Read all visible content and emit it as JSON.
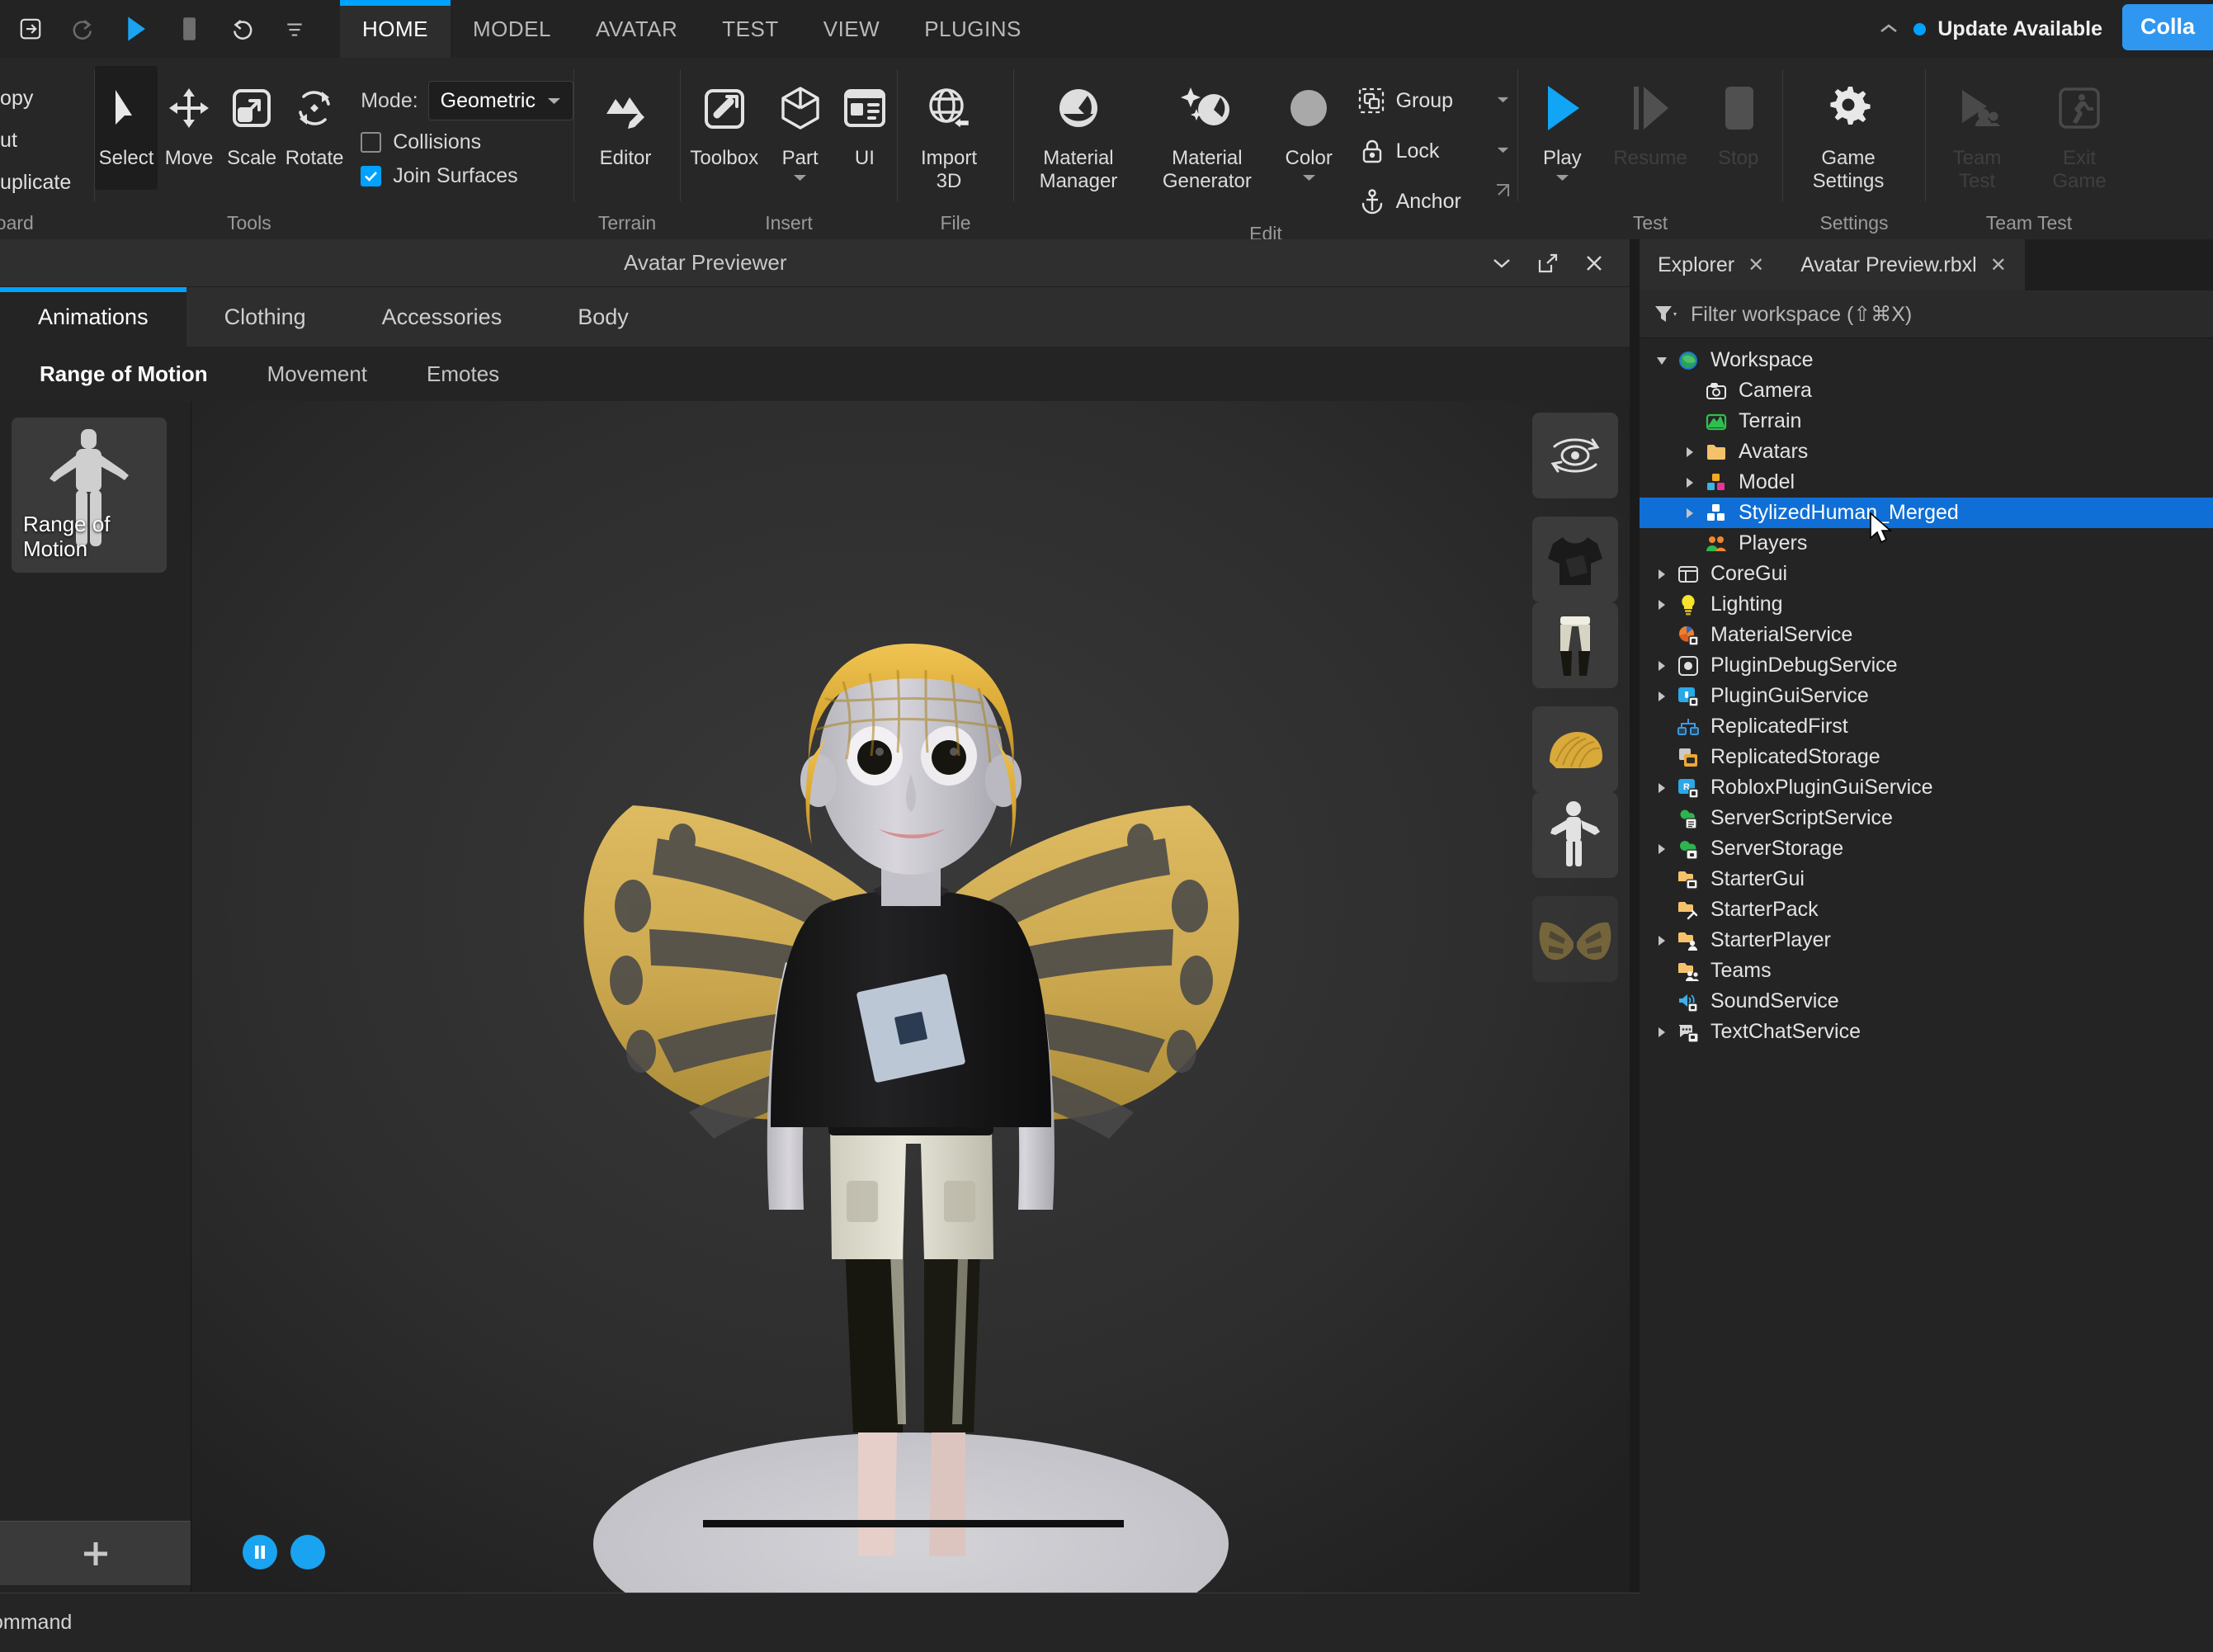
{
  "menubar": {
    "quick_actions": [
      "export-icon",
      "redo-icon",
      "play-icon",
      "stop-icon",
      "undo-icon",
      "more-icon"
    ],
    "tabs": [
      {
        "label": "HOME",
        "active": true
      },
      {
        "label": "MODEL",
        "active": false
      },
      {
        "label": "AVATAR",
        "active": false
      },
      {
        "label": "TEST",
        "active": false
      },
      {
        "label": "VIEW",
        "active": false
      },
      {
        "label": "PLUGINS",
        "active": false
      }
    ],
    "update_label": "Update Available",
    "collab_label": "Colla",
    "accent": "#00a2ff"
  },
  "ribbon": {
    "clipboard": {
      "items": [
        "Copy",
        "Cut",
        "Duplicate"
      ],
      "group_label": "board"
    },
    "tools": {
      "group_label": "Tools",
      "buttons": [
        {
          "label": "Select",
          "icon": "cursor-arrow-icon",
          "selected": true
        },
        {
          "label": "Move",
          "icon": "move-arrows-icon",
          "selected": false
        },
        {
          "label": "Scale",
          "icon": "scale-icon",
          "selected": false
        },
        {
          "label": "Rotate",
          "icon": "rotate-icon",
          "selected": false
        }
      ],
      "mode_label": "Mode:",
      "mode_value": "Geometric",
      "collisions_label": "Collisions",
      "collisions_checked": false,
      "join_surfaces_label": "Join Surfaces",
      "join_surfaces_checked": true
    },
    "terrain": {
      "group_label": "Terrain",
      "buttons": [
        {
          "label": "Editor",
          "icon": "terrain-editor-icon"
        }
      ]
    },
    "insert": {
      "group_label": "Insert",
      "buttons": [
        {
          "label": "Toolbox",
          "icon": "toolbox-icon"
        },
        {
          "label": "Part",
          "icon": "cube-icon",
          "has_caret": true
        },
        {
          "label": "UI",
          "icon": "ui-panel-icon"
        }
      ]
    },
    "file": {
      "group_label": "File",
      "buttons": [
        {
          "label": "Import\n3D",
          "icon": "import-3d-globe-icon"
        }
      ]
    },
    "edit": {
      "group_label": "Edit",
      "buttons": [
        {
          "label": "Material\nManager",
          "icon": "material-sphere-icon"
        },
        {
          "label": "Material\nGenerator",
          "icon": "sparkle-sphere-icon"
        },
        {
          "label": "Color",
          "icon": "color-circle-icon",
          "has_caret": true
        }
      ],
      "rows": [
        {
          "label": "Group",
          "icon": "group-icon",
          "has_caret": true
        },
        {
          "label": "Lock",
          "icon": "lock-icon",
          "has_caret": true
        },
        {
          "label": "Anchor",
          "icon": "anchor-icon",
          "has_caret": false
        }
      ]
    },
    "test": {
      "group_label": "Test",
      "buttons": [
        {
          "label": "Play",
          "icon": "play-triangle-icon",
          "disabled": false,
          "has_caret": true
        },
        {
          "label": "Resume",
          "icon": "resume-icon",
          "disabled": true
        },
        {
          "label": "Stop",
          "icon": "stop-square-icon",
          "disabled": true
        }
      ]
    },
    "settings": {
      "group_label": "Settings",
      "buttons": [
        {
          "label": "Game\nSettings",
          "icon": "gear-icon",
          "disabled": false
        }
      ]
    },
    "team_test": {
      "group_label": "Team Test",
      "buttons": [
        {
          "label": "Team\nTest",
          "icon": "team-test-icon",
          "disabled": true
        },
        {
          "label": "Exit\nGame",
          "icon": "exit-game-icon",
          "disabled": true
        }
      ]
    }
  },
  "previewer": {
    "title": "Avatar Previewer",
    "window_buttons": [
      "chevron-down-icon",
      "popout-icon",
      "close-icon"
    ],
    "tabs": [
      {
        "label": "Animations",
        "active": true
      },
      {
        "label": "Clothing",
        "active": false
      },
      {
        "label": "Accessories",
        "active": false
      },
      {
        "label": "Body",
        "active": false
      }
    ],
    "subtabs": [
      {
        "label": "Range of Motion",
        "active": true
      },
      {
        "label": "Movement",
        "active": false
      },
      {
        "label": "Emotes",
        "active": false
      }
    ],
    "animation_cards": [
      {
        "label": "Range of\nMotion"
      }
    ],
    "add_button_label": "+",
    "viewport_thumbs": [
      {
        "name": "orbit-camera-icon"
      },
      {
        "name": "tshirt-thumbnail"
      },
      {
        "name": "pants-thumbnail"
      },
      {
        "name": "hair-thumbnail"
      },
      {
        "name": "body-thumbnail"
      },
      {
        "name": "wings-thumbnail"
      }
    ],
    "playback": [
      {
        "name": "pause-button"
      },
      {
        "name": "record-button"
      }
    ]
  },
  "explorer": {
    "tabs": [
      {
        "label": "Explorer",
        "active": true
      },
      {
        "label": "Avatar Preview.rbxl",
        "active": false
      }
    ],
    "filter_placeholder": "Filter workspace (⇧⌘X)",
    "tree": [
      {
        "label": "Workspace",
        "depth": 0,
        "arrow": "down",
        "icon": "workspace-icon",
        "selected": false
      },
      {
        "label": "Camera",
        "depth": 1,
        "arrow": "none",
        "icon": "camera-icon",
        "selected": false
      },
      {
        "label": "Terrain",
        "depth": 1,
        "arrow": "none",
        "icon": "terrain-icon",
        "selected": false
      },
      {
        "label": "Avatars",
        "depth": 1,
        "arrow": "right",
        "icon": "folder-icon",
        "selected": false
      },
      {
        "label": "Model",
        "depth": 1,
        "arrow": "right",
        "icon": "model-icon",
        "selected": false
      },
      {
        "label": "StylizedHuman_Merged",
        "depth": 1,
        "arrow": "right",
        "icon": "model-white-icon",
        "selected": true
      },
      {
        "label": "Players",
        "depth": 1,
        "arrow": "none",
        "icon": "players-icon",
        "selected": false
      },
      {
        "label": "CoreGui",
        "depth": 0,
        "arrow": "right",
        "icon": "coregui-icon",
        "selected": false
      },
      {
        "label": "Lighting",
        "depth": 0,
        "arrow": "right",
        "icon": "lighting-icon",
        "selected": false
      },
      {
        "label": "MaterialService",
        "depth": 0,
        "arrow": "none",
        "icon": "material-service-icon",
        "selected": false
      },
      {
        "label": "PluginDebugService",
        "depth": 0,
        "arrow": "right",
        "icon": "plugin-debug-icon",
        "selected": false
      },
      {
        "label": "PluginGuiService",
        "depth": 0,
        "arrow": "right",
        "icon": "plugin-gui-icon",
        "selected": false
      },
      {
        "label": "ReplicatedFirst",
        "depth": 0,
        "arrow": "none",
        "icon": "replicated-first-icon",
        "selected": false
      },
      {
        "label": "ReplicatedStorage",
        "depth": 0,
        "arrow": "none",
        "icon": "replicated-storage-icon",
        "selected": false
      },
      {
        "label": "RobloxPluginGuiService",
        "depth": 0,
        "arrow": "right",
        "icon": "roblox-plugin-gui-icon",
        "selected": false
      },
      {
        "label": "ServerScriptService",
        "depth": 0,
        "arrow": "none",
        "icon": "server-script-icon",
        "selected": false
      },
      {
        "label": "ServerStorage",
        "depth": 0,
        "arrow": "right",
        "icon": "server-storage-icon",
        "selected": false
      },
      {
        "label": "StarterGui",
        "depth": 0,
        "arrow": "none",
        "icon": "starter-gui-icon",
        "selected": false
      },
      {
        "label": "StarterPack",
        "depth": 0,
        "arrow": "none",
        "icon": "starter-pack-icon",
        "selected": false
      },
      {
        "label": "StarterPlayer",
        "depth": 0,
        "arrow": "right",
        "icon": "starter-player-icon",
        "selected": false
      },
      {
        "label": "Teams",
        "depth": 0,
        "arrow": "none",
        "icon": "teams-icon",
        "selected": false
      },
      {
        "label": "SoundService",
        "depth": 0,
        "arrow": "none",
        "icon": "sound-service-icon",
        "selected": false
      },
      {
        "label": "TextChatService",
        "depth": 0,
        "arrow": "right",
        "icon": "text-chat-icon",
        "selected": false
      }
    ],
    "selection_color": "#0f6fd6"
  },
  "statusbar": {
    "text": "ommand"
  }
}
